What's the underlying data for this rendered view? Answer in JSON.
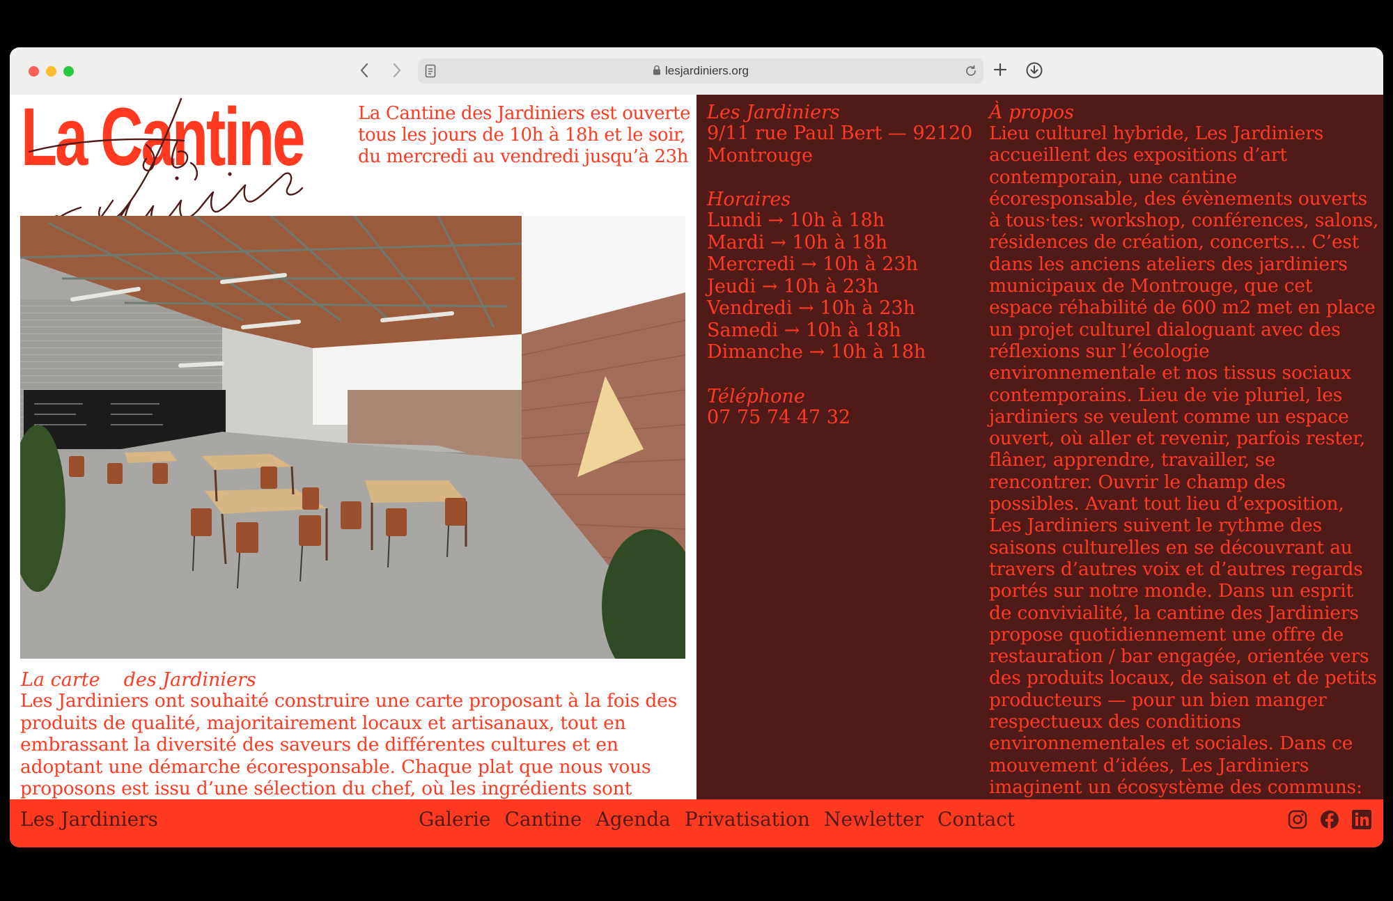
{
  "browser": {
    "url": "lesjardiniers.org"
  },
  "logo": {
    "title": "La Cantine",
    "script": "Les Jardiniers"
  },
  "intro": {
    "text": "La Cantine des Jardiniers est ouverte tous les jours de 10h à 18h et le soir, du mercredi au vendredi jusqu’à 23h"
  },
  "carte": {
    "heading_part1": "La carte",
    "heading_part2": "des Jardiniers",
    "body": "Les Jardiniers ont souhaité construire une carte proposant à la fois des produits de qualité, majoritairement locaux et artisanaux, tout en embrassant la diversité des saveurs de différentes cultures et en adoptant une démarche écoresponsable. Chaque plat que nous vous proposons est issu d’une sélection du chef, où les ingrédients sont choisis avec soin"
  },
  "address": {
    "heading": "Les Jardiniers",
    "line1": "9/11 rue Paul Bert — 92120",
    "line2": "Montrouge"
  },
  "hours": {
    "heading": "Horaires",
    "rows": [
      "Lundi → 10h à 18h",
      "Mardi → 10h à 18h",
      "Mercredi → 10h à 23h",
      "Jeudi → 10h à 23h",
      "Vendredi → 10h à 23h",
      "Samedi → 10h à 18h",
      "Dimanche → 10h à 18h"
    ]
  },
  "phone": {
    "heading": "Téléphone",
    "number": "07 75 74 47 32"
  },
  "apropos": {
    "heading": "À propos",
    "body": "Lieu culturel hybride, Les Jardiniers accueillent des expositions d’art contemporain, une cantine écoresponsable, des évènements ouverts à tous·tes: workshop, conférences, salons, résidences de création, concerts... C’est dans les anciens ateliers des jardiniers municipaux de Montrouge, que cet espace réhabilité de 600 m2 met en place un projet culturel dialoguant avec des réflexions sur l’écologie environnementale et nos tissus sociaux contemporains. Lieu de vie pluriel, les jardiniers se veulent comme un espace ouvert, où aller et revenir, parfois rester, flâner, apprendre, travailler, se rencontrer. Ouvrir le champ des possibles. Avant tout lieu d’exposition, Les Jardiniers suivent le rythme des saisons culturelles en se découvrant au travers d’autres voix et d’autres regards portés sur notre monde. Dans un esprit de convivialité, la cantine des Jardiniers propose quotidiennement une offre de restauration / bar engagée, orientée vers des produits locaux, de saison et de petits producteurs — pour un bien manger respectueux des conditions environnementales et sociales. Dans ce mouvement d’idées, Les Jardiniers imaginent un écosystème des communs:"
  },
  "footer": {
    "brand": "Les Jardiniers",
    "nav": [
      "Galerie",
      "Cantine",
      "Agenda",
      "Privatisation",
      "Newletter",
      "Contact"
    ]
  },
  "icons": {
    "social": [
      "instagram-icon",
      "facebook-icon",
      "linkedin-icon"
    ]
  },
  "colors": {
    "accent": "#ff3a20",
    "dark": "#4f1a18",
    "script": "#4f1a18"
  }
}
